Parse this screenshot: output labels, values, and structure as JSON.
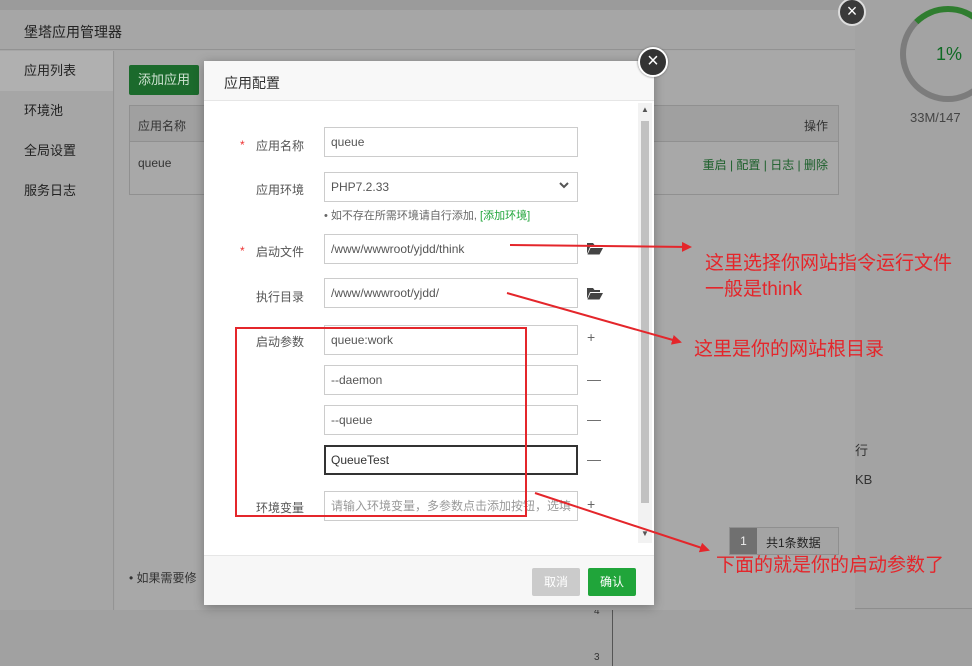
{
  "background": {
    "gauge_value": "1%",
    "memory": "33M/147",
    "row_a": "行",
    "row_b": "KB",
    "axis_4": "4",
    "axis_3": "3"
  },
  "app_window": {
    "title": "堡塔应用管理器",
    "close_symbol": "×",
    "sidebar": [
      {
        "label": "应用列表"
      },
      {
        "label": "环境池"
      },
      {
        "label": "全局设置"
      },
      {
        "label": "服务日志"
      }
    ],
    "add_button": "添加应用",
    "table": {
      "col_name": "应用名称",
      "col_ops": "操作",
      "row_name": "queue",
      "ops": "重启 | 配置 | 日志 | 删除"
    },
    "pager": {
      "page": "1",
      "total": "共1条数据"
    },
    "note": "• 如果需要修"
  },
  "dialog": {
    "title": "应用配置",
    "close_symbol": "×",
    "required_mark": "*",
    "fields": {
      "name_label": "应用名称",
      "name_value": "queue",
      "env_label": "应用环境",
      "env_value": "PHP7.2.33",
      "env_hint": "• 如不存在所需环境请自行添加,",
      "env_hint_link": "[添加环境]",
      "file_label": "启动文件",
      "file_value": "/www/wwwroot/yjdd/think",
      "dir_label": "执行目录",
      "dir_value": "/www/wwwroot/yjdd/",
      "params_label": "启动参数",
      "params": [
        "queue:work",
        "--daemon",
        "--queue",
        "QueueTest"
      ],
      "env_var_label": "环境变量",
      "env_var_placeholder": "请输入环境变量，多参数点击添加按钮，选填"
    },
    "plus_symbol": "+",
    "minus_symbol": "—",
    "cancel_button": "取消",
    "confirm_button": "确认"
  },
  "annotations": {
    "file_note": "这里选择你网站指令运行文件 一般是think",
    "dir_note": "这里是你的网站根目录",
    "params_note": "下面的就是你的启动参数了"
  },
  "colors": {
    "accent_green": "#20a53a",
    "annotation_red": "#e4262b"
  },
  "icons": [
    "close-icon",
    "chevron-down-icon",
    "folder-open-icon",
    "plus-icon",
    "minus-icon"
  ]
}
